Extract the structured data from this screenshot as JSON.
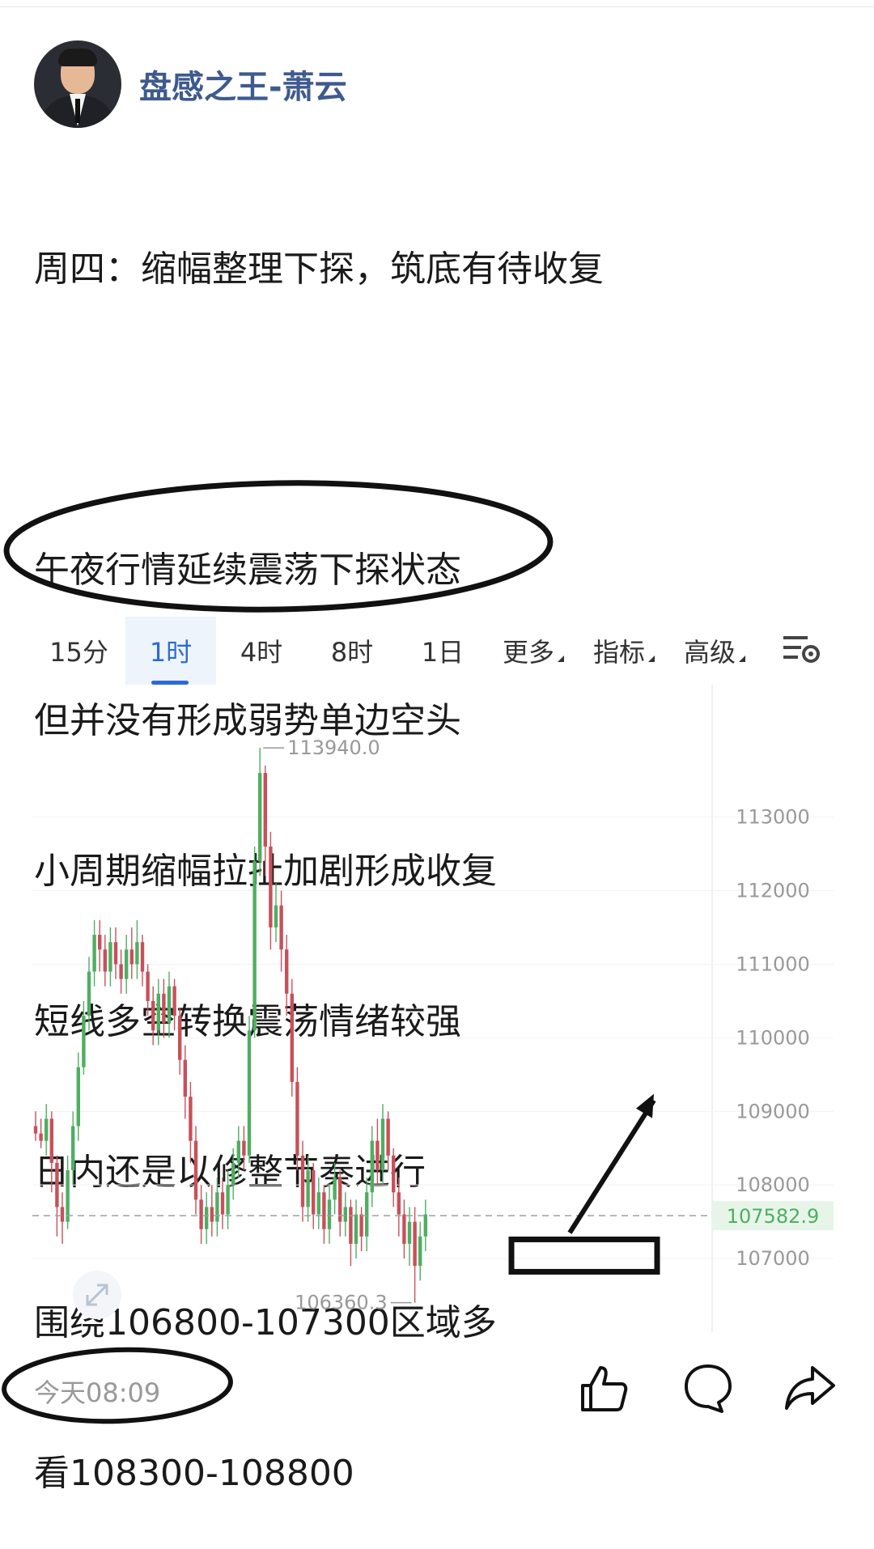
{
  "author": {
    "name": "盘感之王-萧云",
    "avatar_icon": "avatar-icon"
  },
  "post": {
    "lines": [
      "周四：缩幅整理下探，筑底有待收复",
      "",
      "午夜行情延续震荡下探状态",
      "但并没有形成弱势单边空头",
      "小周期缩幅拉扯加剧形成收复",
      "短线多空转换震荡情绪较强",
      "日内还是以修整节奏进行",
      "围绕106800-107300区域多",
      "看108300-108800"
    ]
  },
  "tabs": [
    {
      "label": "15分"
    },
    {
      "label": "1时",
      "active": true
    },
    {
      "label": "4时"
    },
    {
      "label": "8时"
    },
    {
      "label": "1日"
    },
    {
      "label": "更多",
      "dropdown": true
    },
    {
      "label": "指标",
      "dropdown": true
    },
    {
      "label": "高级",
      "dropdown": true
    }
  ],
  "chart_data": {
    "type": "candlestick",
    "ylim": [
      106000,
      114800
    ],
    "yticks": [
      107000,
      108000,
      109000,
      110000,
      111000,
      112000,
      113000
    ],
    "ytick_labels": [
      "107000",
      "108000",
      "109000",
      "110000",
      "111000",
      "112000",
      "113000"
    ],
    "current_price": "107582.9",
    "high_label": "113940.0",
    "low_label": "106360.3",
    "colors": {
      "up": "#4fae62",
      "down": "#c8505a",
      "current_line": "#9aa0a6",
      "price_tag_bg": "#e7f5e9",
      "price_tag_text": "#4fae62"
    },
    "candles": [
      [
        108800,
        108700,
        109000,
        108600
      ],
      [
        108700,
        108600,
        108900,
        108500
      ],
      [
        108600,
        108900,
        109100,
        108400
      ],
      [
        108900,
        108300,
        109000,
        107900
      ],
      [
        108300,
        107700,
        108400,
        107300
      ],
      [
        107700,
        107500,
        107900,
        107200
      ],
      [
        107500,
        108200,
        108400,
        107400
      ],
      [
        108200,
        108800,
        109000,
        108000
      ],
      [
        108800,
        109600,
        109800,
        108600
      ],
      [
        109600,
        110300,
        110500,
        109500
      ],
      [
        110300,
        110900,
        111100,
        110100
      ],
      [
        110900,
        111400,
        111600,
        110700
      ],
      [
        111400,
        111200,
        111600,
        110900
      ],
      [
        111200,
        110900,
        111400,
        110700
      ],
      [
        110900,
        111300,
        111500,
        110700
      ],
      [
        111300,
        111000,
        111500,
        110800
      ],
      [
        111000,
        110800,
        111200,
        110600
      ],
      [
        110800,
        111200,
        111400,
        110600
      ],
      [
        111200,
        111000,
        111500,
        110800
      ],
      [
        111000,
        111300,
        111600,
        110800
      ],
      [
        111300,
        110900,
        111400,
        110700
      ],
      [
        110900,
        110500,
        111000,
        110300
      ],
      [
        110500,
        110100,
        110700,
        109900
      ],
      [
        110100,
        110600,
        110800,
        109900
      ],
      [
        110600,
        110200,
        110800,
        110000
      ],
      [
        110200,
        110700,
        110900,
        110000
      ],
      [
        110700,
        110300,
        110800,
        110100
      ],
      [
        110300,
        109700,
        110400,
        109500
      ],
      [
        109700,
        109200,
        109900,
        108900
      ],
      [
        109200,
        108600,
        109400,
        108300
      ],
      [
        108600,
        107800,
        108800,
        107600
      ],
      [
        107800,
        107400,
        108000,
        107200
      ],
      [
        107400,
        107700,
        107900,
        107200
      ],
      [
        107700,
        107500,
        108000,
        107300
      ],
      [
        107500,
        107900,
        108100,
        107300
      ],
      [
        107900,
        107600,
        108100,
        107400
      ],
      [
        107600,
        108000,
        108200,
        107400
      ],
      [
        108000,
        108300,
        108500,
        107800
      ],
      [
        108300,
        108600,
        108800,
        108100
      ],
      [
        108600,
        108400,
        108800,
        108200
      ],
      [
        108400,
        110100,
        110300,
        108300
      ],
      [
        110100,
        112400,
        112600,
        110000
      ],
      [
        112400,
        113600,
        113940,
        112200
      ],
      [
        113600,
        112600,
        113700,
        112200
      ],
      [
        112600,
        111500,
        112800,
        111200
      ],
      [
        111500,
        111800,
        112100,
        111300
      ],
      [
        111800,
        111200,
        112000,
        110900
      ],
      [
        111200,
        110600,
        111400,
        110300
      ],
      [
        110600,
        109400,
        110800,
        109200
      ],
      [
        109400,
        108400,
        109600,
        108200
      ],
      [
        108400,
        107700,
        108600,
        107500
      ],
      [
        107700,
        108200,
        108400,
        107500
      ],
      [
        108200,
        107600,
        108300,
        107400
      ],
      [
        107600,
        107900,
        108100,
        107400
      ],
      [
        107900,
        107400,
        108000,
        107200
      ],
      [
        107400,
        107800,
        108000,
        107200
      ],
      [
        107800,
        108100,
        108300,
        107600
      ],
      [
        108100,
        107500,
        108200,
        107300
      ],
      [
        107500,
        107700,
        107900,
        107300
      ],
      [
        107700,
        107200,
        107800,
        106900
      ],
      [
        107200,
        107600,
        107800,
        107000
      ],
      [
        107600,
        107300,
        107700,
        107100
      ],
      [
        107300,
        107900,
        108100,
        107100
      ],
      [
        107900,
        108600,
        108800,
        107700
      ],
      [
        108600,
        108200,
        108900,
        108000
      ],
      [
        108200,
        108900,
        109100,
        108000
      ],
      [
        108900,
        108400,
        109000,
        108200
      ],
      [
        108400,
        107900,
        108500,
        107700
      ],
      [
        107900,
        107600,
        108100,
        107300
      ],
      [
        107600,
        107200,
        107800,
        107000
      ],
      [
        107200,
        107500,
        107700,
        106900
      ],
      [
        107500,
        106900,
        107700,
        106400
      ],
      [
        106900,
        107300,
        107500,
        106700
      ],
      [
        107300,
        107600,
        107800,
        107100
      ]
    ]
  },
  "footer": {
    "time": "今天08:09"
  },
  "actions": [
    {
      "name": "like-icon"
    },
    {
      "name": "comment-icon"
    },
    {
      "name": "share-icon"
    }
  ]
}
